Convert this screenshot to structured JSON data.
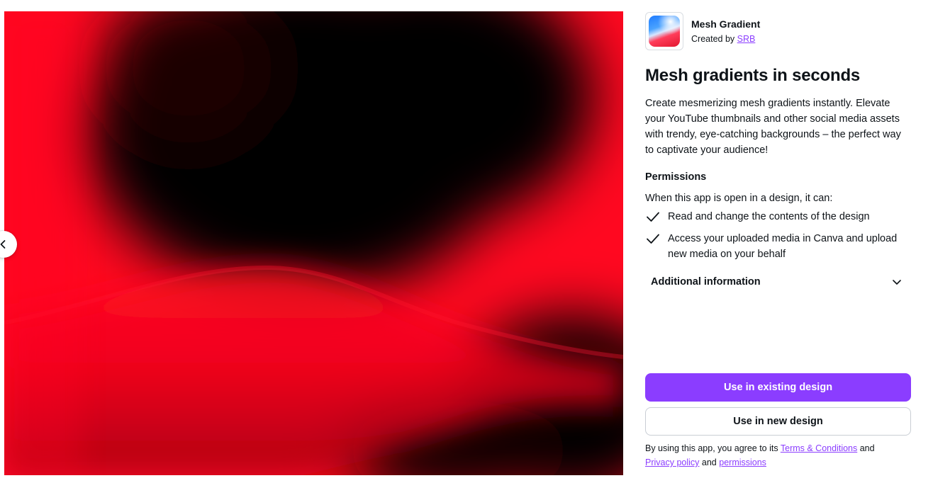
{
  "app": {
    "name": "Mesh Gradient",
    "created_by_prefix": "Created by",
    "creator": "SRB"
  },
  "headline": "Mesh gradients in seconds",
  "description": "Create mesmerizing mesh gradients instantly. Elevate your YouTube thumbnails and other social media assets with trendy, eye-catching backgrounds – the perfect way to captivate your audience!",
  "permissions": {
    "title": "Permissions",
    "intro": "When this app is open in a design, it can:",
    "items": [
      "Read and change the contents of the design",
      "Access your uploaded media in Canva and upload new media on your behalf"
    ]
  },
  "additional_info_label": "Additional information",
  "buttons": {
    "existing": "Use in existing design",
    "new": "Use in new design"
  },
  "terms": {
    "prefix": "By using this app, you agree to its",
    "terms_link": "Terms & Conditions",
    "and1": "and",
    "privacy_link": "Privacy policy",
    "and2": "and",
    "permissions_link": "permissions"
  },
  "icons": {
    "carousel_prev": "chevron-left-icon",
    "check": "check-icon",
    "expand": "chevron-down-icon"
  },
  "colors": {
    "accent": "#8b3dff",
    "preview_red": "#ff0a23",
    "preview_dark": "#050000"
  }
}
